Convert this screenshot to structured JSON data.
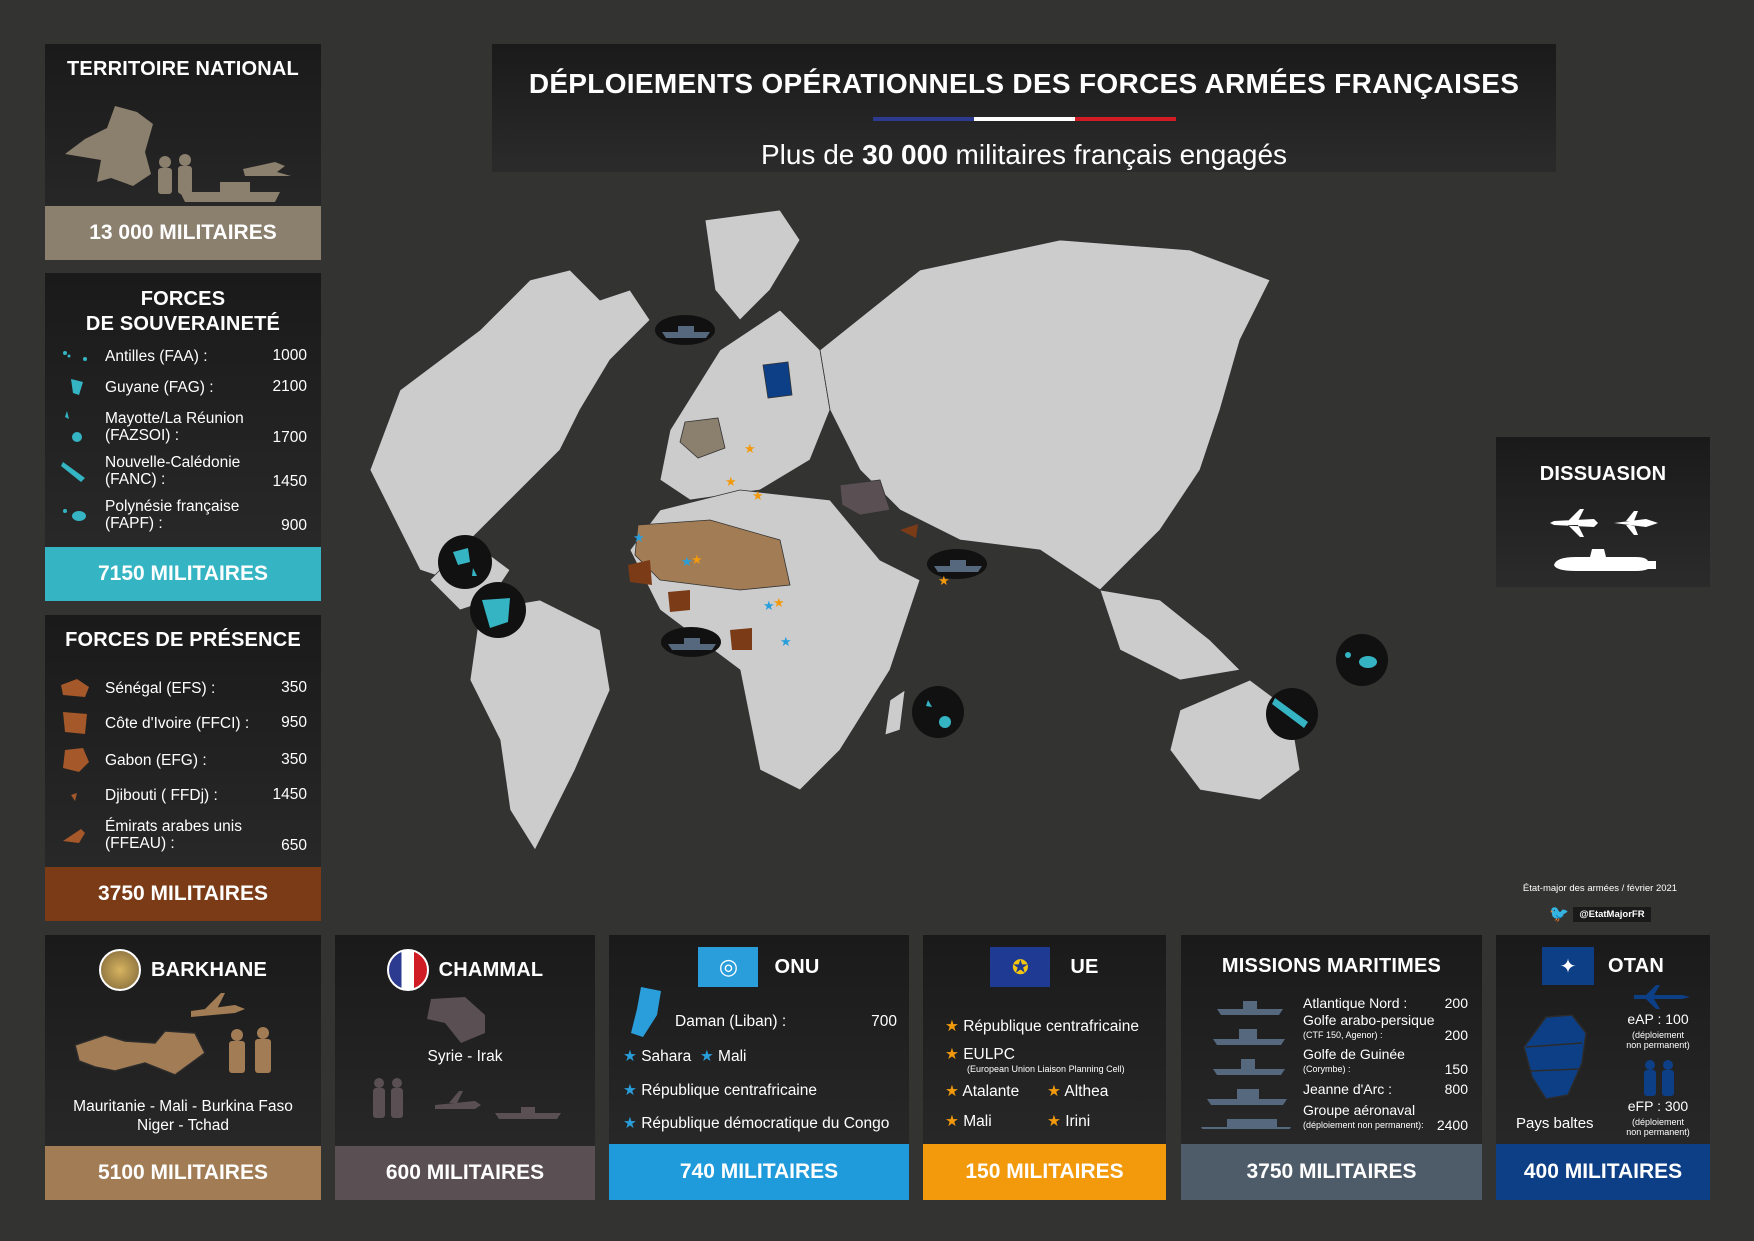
{
  "header": {
    "title": "DÉPLOIEMENTS OPÉRATIONNELS DES FORCES ARMÉES FRANÇAISES",
    "subtitle_pre": "Plus de ",
    "subtitle_bold": "30 000",
    "subtitle_post": " militaires français engagés"
  },
  "colors": {
    "background": "#333332",
    "national": "#8b7f6d",
    "souverainete": "#35b4c4",
    "presence": "#7a3b16",
    "barkhane": "#a17c55",
    "chammal": "#5a4f52",
    "onu": "#1f9bdb",
    "ue": "#f29a0c",
    "maritime": "#4e5b69",
    "otan": "#0d3f86",
    "map_land": "#cccccc"
  },
  "territoire": {
    "title": "TERRITOIRE NATIONAL",
    "total": "13 000 MILITAIRES"
  },
  "souverainete": {
    "title1": "FORCES",
    "title2": "DE SOUVERAINETÉ",
    "items": [
      {
        "label": "Antilles (FAA) :",
        "value": "1000",
        "icon": "antilles-icon"
      },
      {
        "label": "Guyane (FAG) :",
        "value": "2100",
        "icon": "guyane-icon"
      },
      {
        "label": "Mayotte/La Réunion (FAZSOI) :",
        "value": "1700",
        "icon": "reunion-icon"
      },
      {
        "label": "Nouvelle-Calédonie (FANC) :",
        "value": "1450",
        "icon": "caledonie-icon"
      },
      {
        "label": "Polynésie française (FAPF) :",
        "value": "900",
        "icon": "polynesie-icon"
      }
    ],
    "total": "7150 MILITAIRES"
  },
  "presence": {
    "title": "FORCES DE PRÉSENCE",
    "items": [
      {
        "label": "Sénégal (EFS) :",
        "value": "350"
      },
      {
        "label": "Côte d'Ivoire  (FFCI) :",
        "value": "950"
      },
      {
        "label": "Gabon (EFG) :",
        "value": "350"
      },
      {
        "label": "Djibouti ( FFDj) :",
        "value": "1450"
      },
      {
        "label": "Émirats arabes unis (FFEAU) :",
        "value": "650"
      }
    ],
    "total": "3750 MILITAIRES"
  },
  "dissuasion": {
    "title": "DISSUASION"
  },
  "barkhane": {
    "title": "BARKHANE",
    "line1": "Mauritanie - Mali - Burkina Faso",
    "line2": "Niger - Tchad",
    "total": "5100 MILITAIRES"
  },
  "chammal": {
    "title": "CHAMMAL",
    "caption": "Syrie - Irak",
    "total": "600 MILITAIRES"
  },
  "onu": {
    "title": "ONU",
    "daman_label": "Daman (Liban) :",
    "daman_value": "700",
    "sahara": "Sahara",
    "mali": "Mali",
    "rca": "République centrafricaine",
    "rdc": "République démocratique du Congo",
    "total": "740 MILITAIRES"
  },
  "ue": {
    "title": "UE",
    "rca": "République centrafricaine",
    "eulpc": "EULPC",
    "eulpc_sub": "(European Union Liaison Planning Cell)",
    "atalante": "Atalante",
    "althea": "Althea",
    "mali": "Mali",
    "irini": "Irini",
    "total": "150 MILITAIRES"
  },
  "maritime": {
    "title": "MISSIONS MARITIMES",
    "items": [
      {
        "label": "Atlantique Nord :",
        "sub": "",
        "value": "200"
      },
      {
        "label": "Golfe arabo-persique",
        "sub": "(CTF 150, Agenor) :",
        "value": "200"
      },
      {
        "label": "Golfe de Guinée",
        "sub": "(Corymbe) :",
        "value": "150"
      },
      {
        "label": "Jeanne d'Arc :",
        "sub": "",
        "value": "800"
      },
      {
        "label": "Groupe aéronaval",
        "sub": "(déploiement non permanent):",
        "value": "2400"
      }
    ],
    "total": "3750 MILITAIRES"
  },
  "otan": {
    "title": "OTAN",
    "eap": "eAP : 100",
    "eap_sub1": "(déploiement",
    "eap_sub2": "non permanent)",
    "efp": "eFP : 300",
    "efp_sub1": "(déploiement",
    "efp_sub2": "non permanent)",
    "baltes": "Pays baltes",
    "total": "400 MILITAIRES"
  },
  "credit": {
    "line": "État-major des armées / février 2021",
    "twitter": "@EtatMajorFR"
  }
}
